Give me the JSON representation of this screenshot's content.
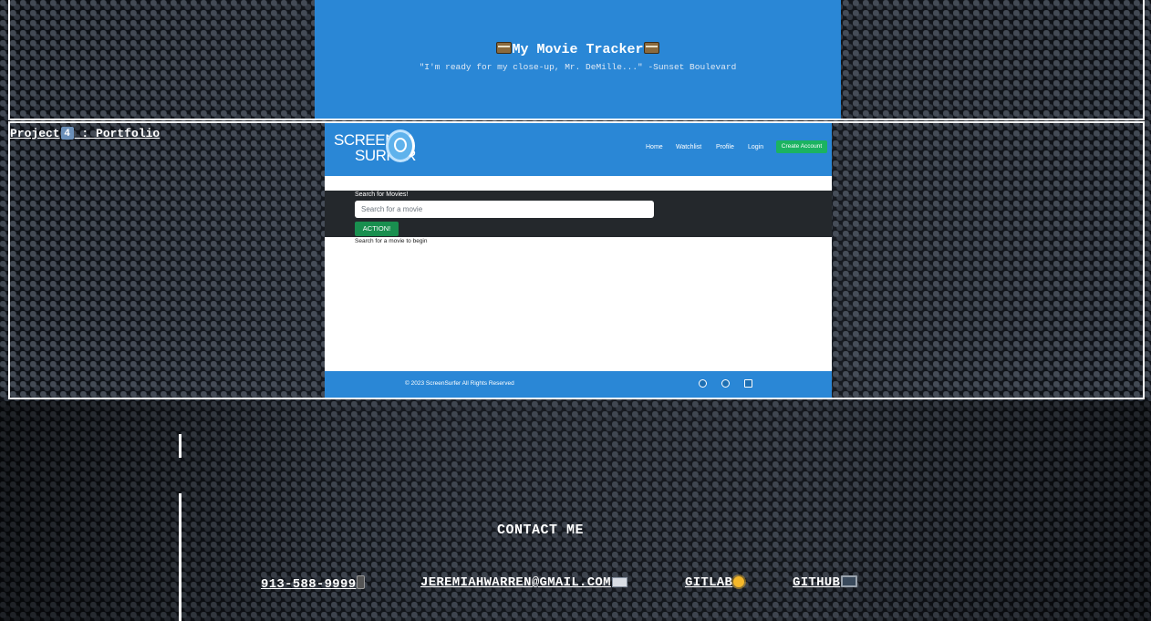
{
  "projects": {
    "tracker": {
      "title": "My Movie Tracker",
      "quote": "\"I'm ready for my close-up, Mr. DeMille...\" -Sunset Boulevard"
    },
    "portfolio": {
      "link_prefix": "Project",
      "number": "4",
      "link_suffix": " : Portfolio",
      "screenshot": {
        "logo_line1": "SCREEN",
        "logo_line2": "SURFER",
        "nav": [
          "Home",
          "Watchlist",
          "Profile",
          "Login"
        ],
        "create_account": "Create Account",
        "search_label": "Search for Movies!",
        "search_placeholder": "Search for a movie",
        "action_button": "ACTION!",
        "hint": "Search for a movie to begin",
        "copyright": "© 2023 ScreenSurfer All Rights Reserved"
      }
    }
  },
  "contact": {
    "heading": "CONTACT ME",
    "phone": "913-588-9999",
    "email": "JEREMIAHWARREN@GMAIL.COM",
    "gitlab": "GITLAB",
    "github": "GITHUB",
    "icons": [
      "phone-icon",
      "email-icon",
      "sun-icon",
      "computer-icon"
    ]
  },
  "colors": {
    "screenshot_blue": "#2a87d6",
    "create_green": "#1bb361",
    "action_green": "#198f4f",
    "search_bar_dark": "#24282c"
  }
}
